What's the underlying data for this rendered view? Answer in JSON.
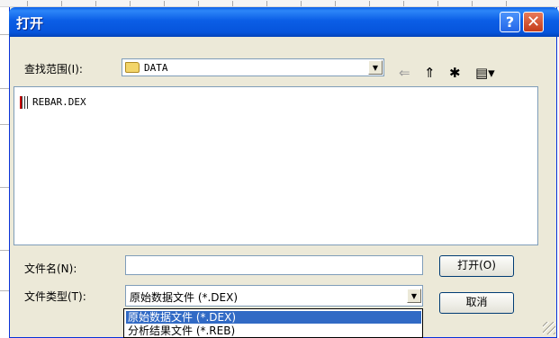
{
  "window": {
    "title": "打开"
  },
  "title_buttons": {
    "help": "?",
    "close": "✕"
  },
  "look_in": {
    "label": "查找范围(I):",
    "value": "DATA",
    "dropdown_glyph": "▼"
  },
  "toolbar_icons": {
    "back": "⇐",
    "up": "⇑",
    "new_folder": "✱",
    "view": "▤▾"
  },
  "file_list": {
    "items": [
      "REBAR.DEX"
    ]
  },
  "file_name": {
    "label": "文件名(N):",
    "value": ""
  },
  "file_type": {
    "label": "文件类型(T):",
    "value": "原始数据文件 (*.DEX)",
    "dropdown_glyph": "▼",
    "options": [
      "原始数据文件 (*.DEX)",
      "分析结果文件 (*.REB)"
    ]
  },
  "buttons": {
    "open": "打开(O)",
    "cancel": "取消"
  },
  "colors": {
    "title_bar": "#0a5fe8",
    "dialog_bg": "#ece9d8",
    "selection": "#316ac5"
  }
}
